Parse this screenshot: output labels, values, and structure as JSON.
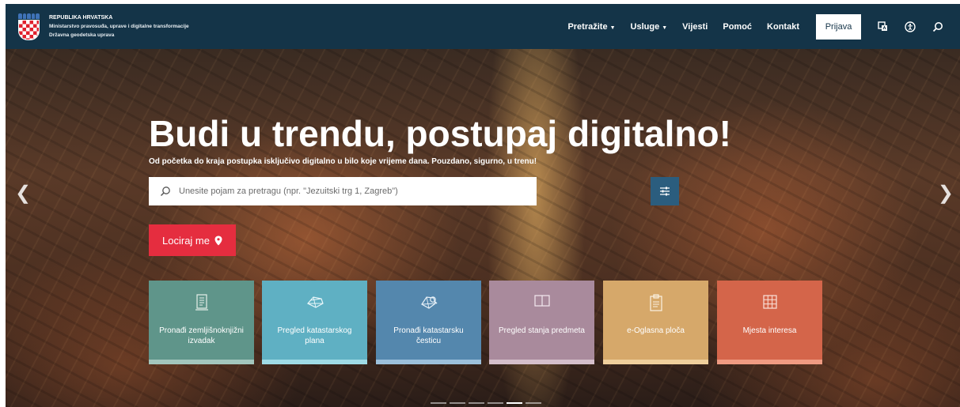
{
  "header": {
    "org_line1": "REPUBLIKA HRVATSKA",
    "org_line2": "Ministarstvo pravosuđa, uprave i digitalne transformacije",
    "org_line3": "Državna geodetska uprava",
    "nav": [
      {
        "label": "Pretražite",
        "dropdown": true
      },
      {
        "label": "Usluge",
        "dropdown": true
      },
      {
        "label": "Vijesti",
        "dropdown": false
      },
      {
        "label": "Pomoć",
        "dropdown": false
      },
      {
        "label": "Kontakt",
        "dropdown": false
      }
    ],
    "login_label": "Prijava",
    "icons": [
      "translate-icon",
      "accessibility-icon",
      "search-icon"
    ]
  },
  "hero": {
    "headline": "Budi u trendu, postupaj digitalno!",
    "subtitle": "Od početka do kraja postupka isključivo digitalno u bilo koje vrijeme dana. Pouzdano, sigurno, u trenu!",
    "search_placeholder": "Unesite pojam za pretragu (npr. \"Jezuitski trg 1, Zagreb\")",
    "locate_label": "Lociraj me",
    "slides_count": 6,
    "active_slide": 5
  },
  "cards": [
    {
      "label": "Pronađi zemljišnoknjižni izvadak",
      "icon": "document-icon",
      "color": "#5f958a",
      "bar": "#a3c6bd"
    },
    {
      "label": "Pregled katastarskog plana",
      "icon": "map-parcels-icon",
      "color": "#5fb0c3",
      "bar": "#9fdbe6"
    },
    {
      "label": "Pronađi katastarsku česticu",
      "icon": "parcel-search-icon",
      "color": "#5487ad",
      "bar": "#9cc0db"
    },
    {
      "label": "Pregled stanja predmeta",
      "icon": "book-icon",
      "color": "#a98a9c",
      "bar": "#d5bfcb"
    },
    {
      "label": "e-Oglasna ploča",
      "icon": "clipboard-icon",
      "color": "#d6a86a",
      "bar": "#efcf9c"
    },
    {
      "label": "Mjesta interesa",
      "icon": "grid-icon",
      "color": "#d4654a",
      "bar": "#f09b82"
    }
  ]
}
